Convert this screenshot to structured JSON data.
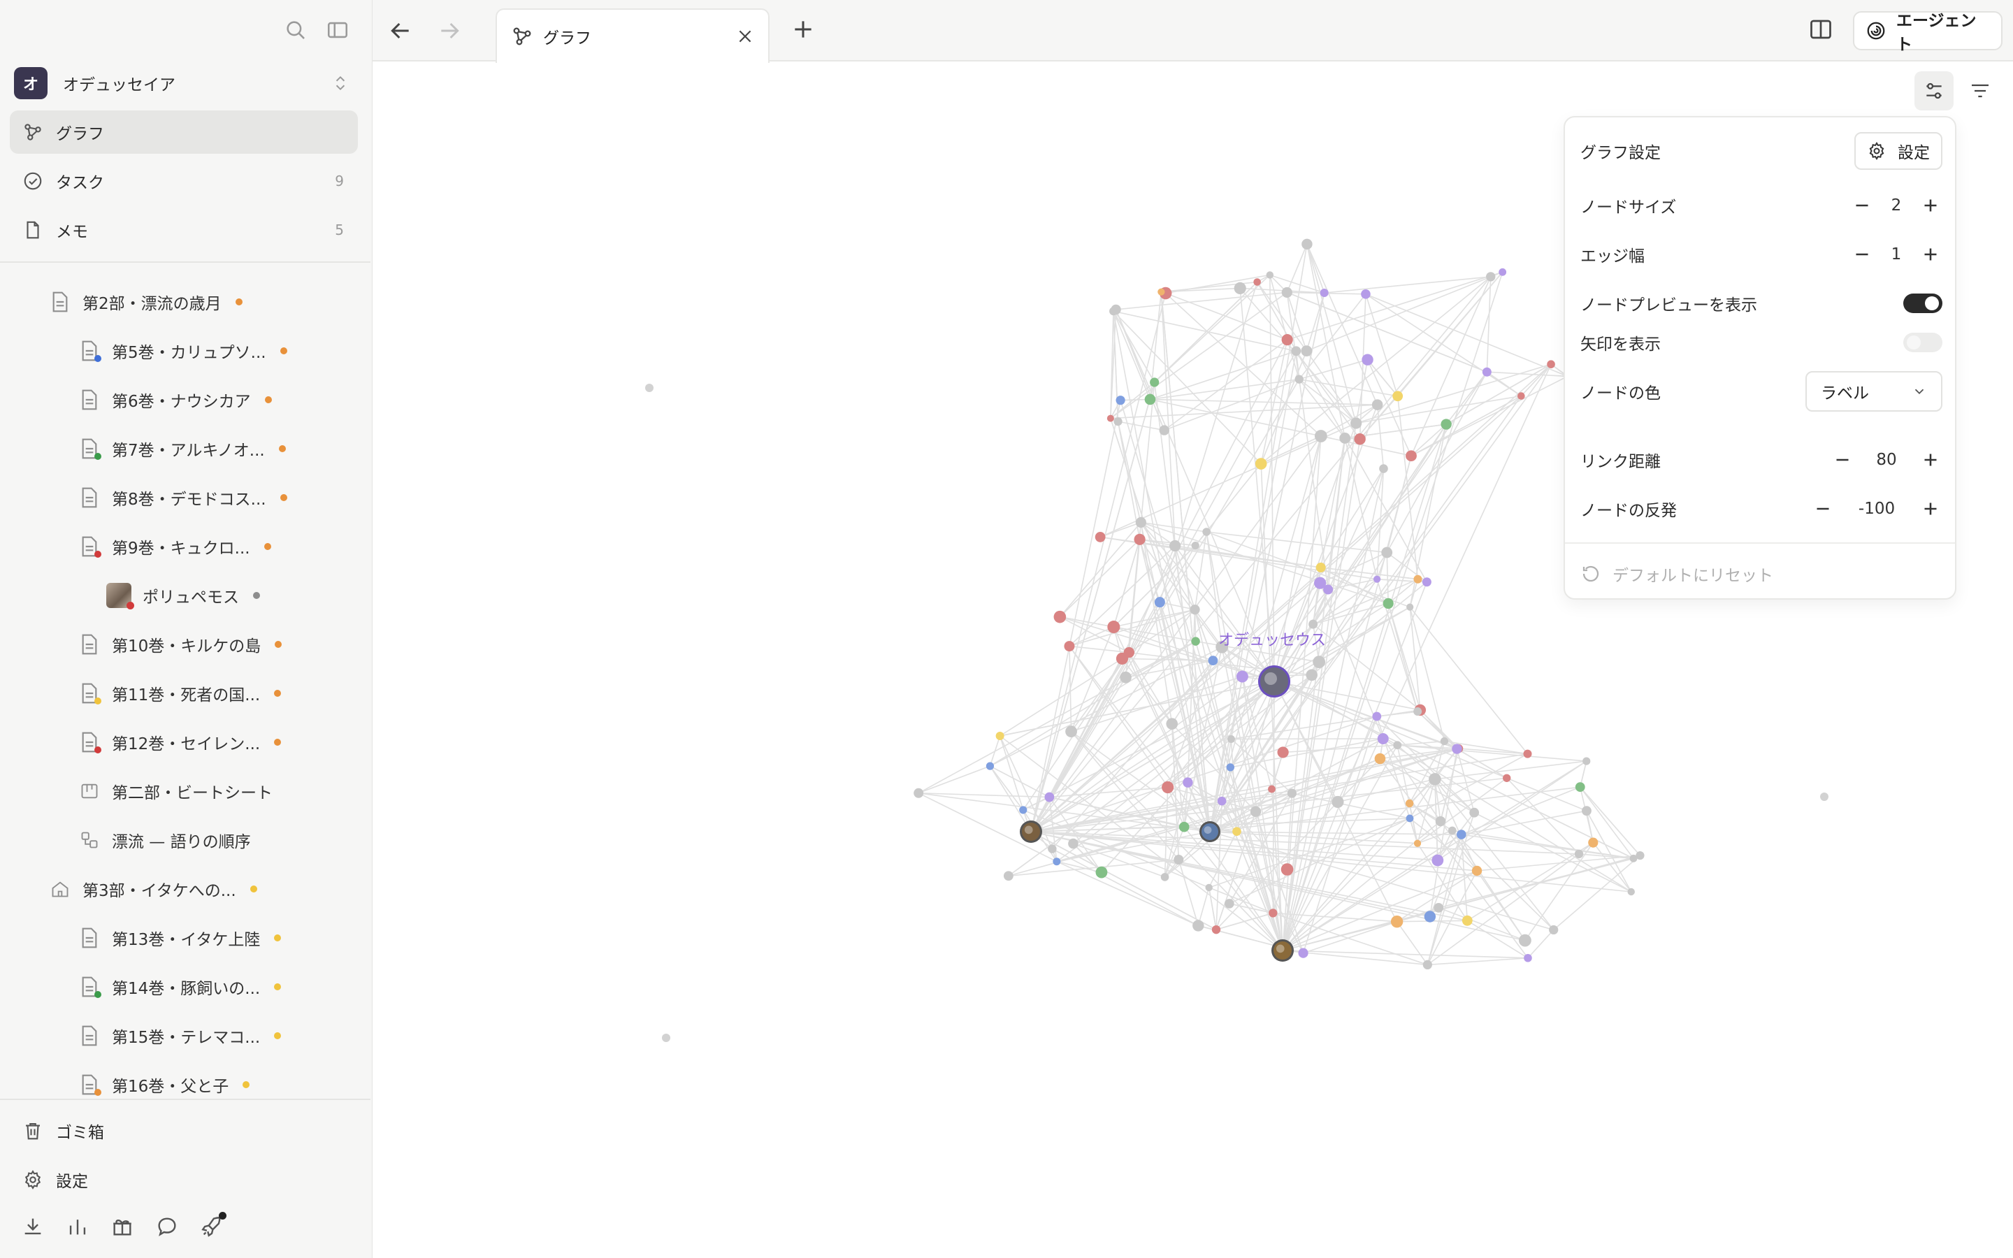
{
  "workspace": {
    "initial": "オ",
    "name": "オデュッセイア"
  },
  "nav": [
    {
      "label": "グラフ",
      "count": ""
    },
    {
      "label": "タスク",
      "count": "9"
    },
    {
      "label": "メモ",
      "count": "5"
    }
  ],
  "tree": [
    {
      "label": "第2部・漂流の歳月",
      "dot": "#e8913a"
    },
    {
      "label": "第5巻・カリュプソ...",
      "dot": "#e8913a",
      "sub": "#3f6fd8"
    },
    {
      "label": "第6巻・ナウシカア",
      "dot": "#e8913a"
    },
    {
      "label": "第7巻・アルキノオ...",
      "dot": "#e8913a",
      "sub": "#3b9b4a"
    },
    {
      "label": "第8巻・デモドコス...",
      "dot": "#e8913a"
    },
    {
      "label": "第9巻・キュクロ...",
      "dot": "#e8913a",
      "sub": "#d13b3b"
    },
    {
      "label": "ポリュペモス",
      "dot": "#8d8d8d",
      "sub": "#d13b3b"
    },
    {
      "label": "第10巻・キルケの島",
      "dot": "#e8913a"
    },
    {
      "label": "第11巻・死者の国...",
      "dot": "#e8913a",
      "sub": "#f0c33c"
    },
    {
      "label": "第12巻・セイレン...",
      "dot": "#e8913a",
      "sub": "#d13b3b"
    },
    {
      "label": "第二部・ビートシート",
      "dot": ""
    },
    {
      "label": "漂流 — 語りの順序",
      "dot": ""
    },
    {
      "label": "第3部・イタケへの...",
      "dot": "#f0c33c"
    },
    {
      "label": "第13巻・イタケ上陸",
      "dot": "#f0c33c"
    },
    {
      "label": "第14巻・豚飼いの...",
      "dot": "#f0c33c",
      "sub": "#3b9b4a"
    },
    {
      "label": "第15巻・テレマコ...",
      "dot": "#f0c33c"
    },
    {
      "label": "第16巻・父と子",
      "dot": "#f0c33c",
      "sub": "#e8913a"
    }
  ],
  "bottom_nav": [
    {
      "label": "ゴミ箱"
    },
    {
      "label": "設定"
    }
  ],
  "tab": {
    "label": "グラフ"
  },
  "agent_button": "エージェント",
  "graph": {
    "highlight_label": "オデュッセウス",
    "colors": {
      "gray": "#c8c8c8",
      "red": "#d98383",
      "green": "#82bf86",
      "orange": "#efb36d",
      "yellow": "#f2d56a",
      "blue": "#7f9fe0",
      "purple": "#b59be8",
      "edge": "#e0e0e0"
    }
  },
  "panel": {
    "title": "グラフ設定",
    "settings_button": "設定",
    "node_size": {
      "label": "ノードサイズ",
      "value": "2"
    },
    "edge_width": {
      "label": "エッジ幅",
      "value": "1"
    },
    "node_preview": {
      "label": "ノードプレビューを表示",
      "on": true
    },
    "arrows": {
      "label": "矢印を表示",
      "on": false
    },
    "node_color": {
      "label": "ノードの色",
      "value": "ラベル"
    },
    "link_distance": {
      "label": "リンク距離",
      "value": "80"
    },
    "repulsion": {
      "label": "ノードの反発",
      "value": "-100"
    },
    "reset": "デフォルトにリセット"
  }
}
